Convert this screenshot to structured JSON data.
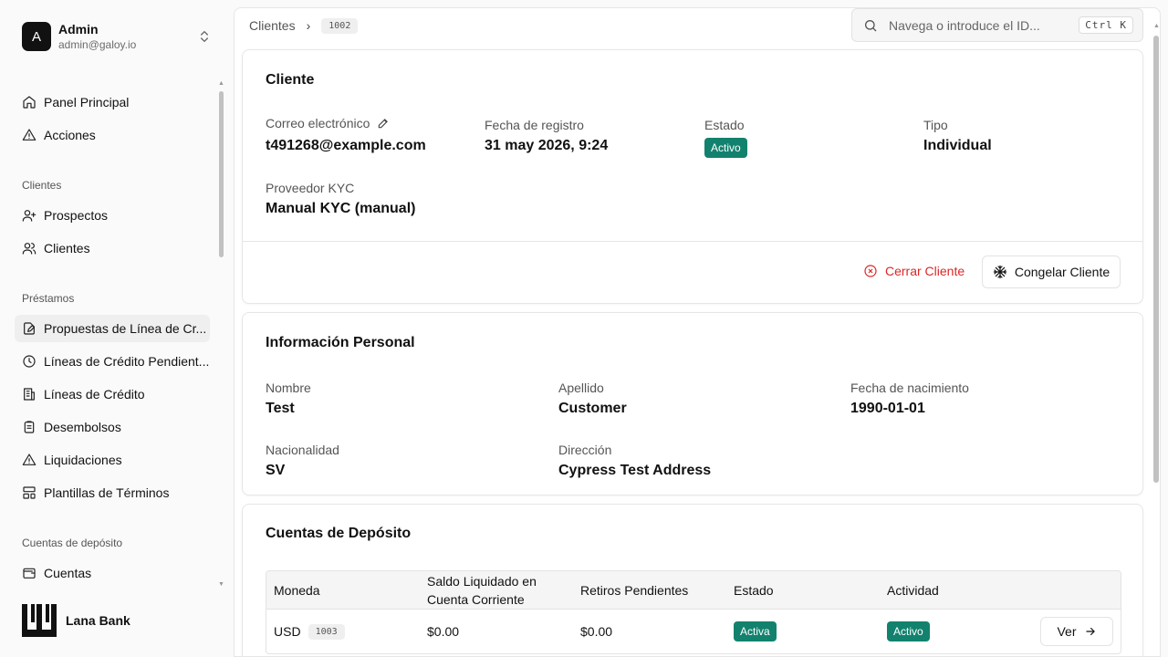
{
  "user": {
    "initial": "A",
    "name": "Admin",
    "email": "admin@galoy.io"
  },
  "nav": {
    "top": [
      {
        "label": "Panel Principal",
        "icon": "home-icon"
      },
      {
        "label": "Acciones",
        "icon": "alert-triangle-icon"
      }
    ],
    "groups": [
      {
        "label": "Clientes",
        "items": [
          {
            "label": "Prospectos",
            "icon": "user-plus-icon"
          },
          {
            "label": "Clientes",
            "icon": "users-icon"
          }
        ]
      },
      {
        "label": "Préstamos",
        "items": [
          {
            "label": "Propuestas de Línea de Cr...",
            "icon": "file-edit-icon",
            "active": true
          },
          {
            "label": "Líneas de Crédito Pendient...",
            "icon": "clock-icon"
          },
          {
            "label": "Líneas de Crédito",
            "icon": "building-icon"
          },
          {
            "label": "Desembolsos",
            "icon": "clipboard-icon"
          },
          {
            "label": "Liquidaciones",
            "icon": "alert-triangle-icon"
          },
          {
            "label": "Plantillas de Términos",
            "icon": "layout-template-icon"
          }
        ]
      },
      {
        "label": "Cuentas de depósito",
        "items": [
          {
            "label": "Cuentas",
            "icon": "wallet-icon"
          }
        ]
      }
    ]
  },
  "brand": {
    "name": "Lana Bank"
  },
  "breadcrumb": {
    "parent": "Clientes",
    "id": "1002"
  },
  "search": {
    "placeholder": "Navega o introduce el ID...",
    "shortcut": "Ctrl K"
  },
  "client_card": {
    "title": "Cliente",
    "email_label": "Correo electrónico",
    "email": "t491268@example.com",
    "registered_label": "Fecha de registro",
    "registered": "31 may 2026, 9:24",
    "status_label": "Estado",
    "status": "Activo",
    "type_label": "Tipo",
    "type": "Individual",
    "kyc_label": "Proveedor KYC",
    "kyc": "Manual KYC (manual)",
    "close_button": "Cerrar Cliente",
    "freeze_button": "Congelar Cliente"
  },
  "personal_card": {
    "title": "Información Personal",
    "first_name_label": "Nombre",
    "first_name": "Test",
    "last_name_label": "Apellido",
    "last_name": "Customer",
    "dob_label": "Fecha de nacimiento",
    "dob": "1990-01-01",
    "nationality_label": "Nacionalidad",
    "nationality": "SV",
    "address_label": "Dirección",
    "address": "Cypress Test Address"
  },
  "deposit_card": {
    "title": "Cuentas de Depósito",
    "columns": [
      "Moneda",
      "Saldo Liquidado en Cuenta Corriente",
      "Retiros Pendientes",
      "Estado",
      "Actividad"
    ],
    "rows": [
      {
        "currency": "USD",
        "id": "1003",
        "settled": "$0.00",
        "pending": "$0.00",
        "status": "Activa",
        "activity": "Activo",
        "action": "Ver"
      }
    ]
  },
  "colors": {
    "accent_badge": "#12826e",
    "danger": "#dc2626"
  }
}
